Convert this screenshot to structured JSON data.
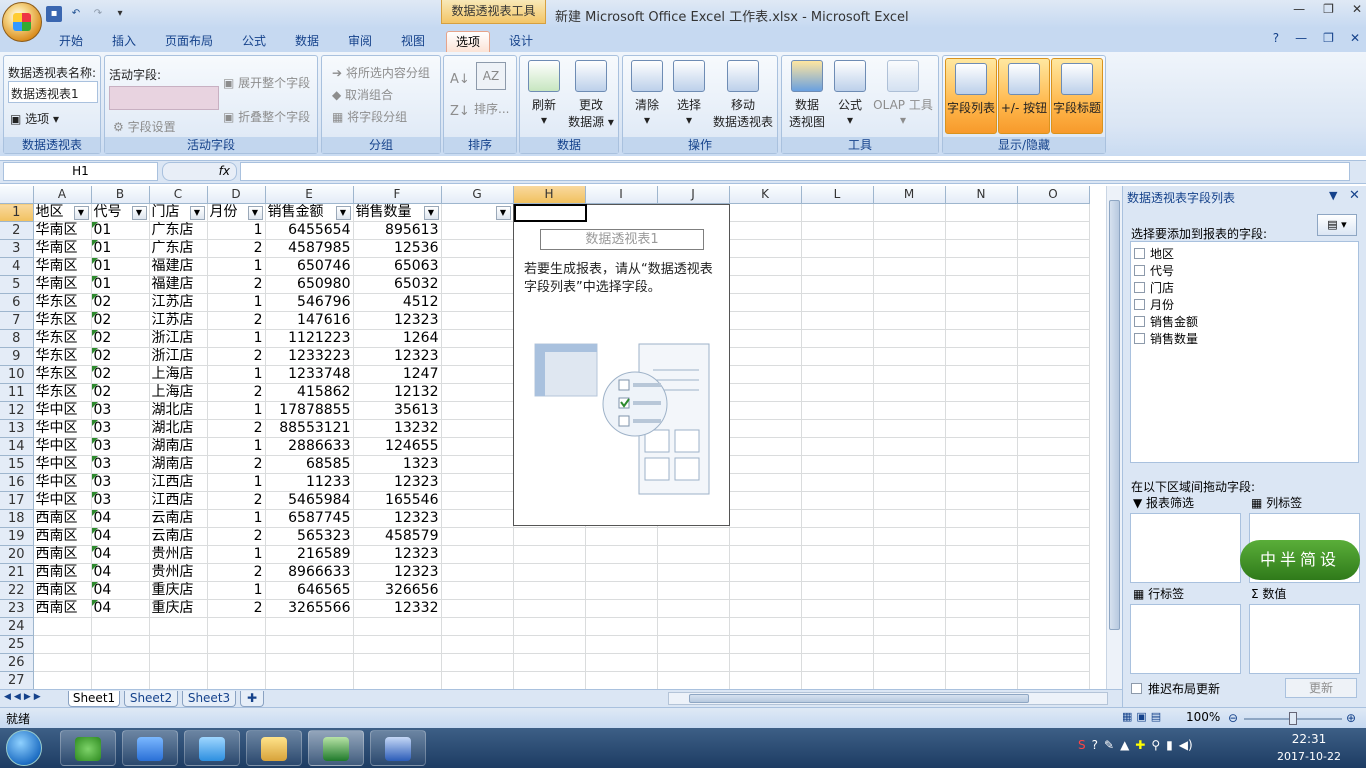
{
  "window": {
    "title": "新建 Microsoft Office Excel 工作表.xlsx - Microsoft Excel",
    "context_tab": "数据透视表工具"
  },
  "tabs": [
    "开始",
    "插入",
    "页面布局",
    "公式",
    "数据",
    "审阅",
    "视图",
    "选项",
    "设计"
  ],
  "active_tab": "选项",
  "ribbon": {
    "pivot": {
      "name_label": "数据透视表名称:",
      "name_value": "数据透视表1",
      "options": "选项",
      "group": "数据透视表"
    },
    "active_field": {
      "label": "活动字段:",
      "field_settings": "字段设置",
      "expand": "展开整个字段",
      "collapse": "折叠整个字段",
      "group": "活动字段"
    },
    "grouping": {
      "group_selection": "将所选内容分组",
      "ungroup": "取消组合",
      "group_field": "将字段分组",
      "group": "分组"
    },
    "sort": {
      "sort": "排序...",
      "group": "排序"
    },
    "data": {
      "refresh": "刷新",
      "change_source_1": "更改",
      "change_source_2": "数据源",
      "group": "数据"
    },
    "actions": {
      "clear": "清除",
      "select": "选择",
      "move_1": "移动",
      "move_2": "数据透视表",
      "group": "操作"
    },
    "tools": {
      "pivotchart_1": "数据",
      "pivotchart_2": "透视图",
      "formulas": "公式",
      "olap": "OLAP 工具",
      "group": "工具"
    },
    "show_hide": {
      "field_list": "字段列表",
      "buttons": "+/- 按钮",
      "headers": "字段标题",
      "group": "显示/隐藏"
    }
  },
  "formula_bar": {
    "name_box": "H1",
    "fx": "fx"
  },
  "columns": [
    "A",
    "B",
    "C",
    "D",
    "E",
    "F",
    "G",
    "H",
    "I",
    "J",
    "K",
    "L",
    "M",
    "N",
    "O"
  ],
  "headers": [
    "地区",
    "代号",
    "门店",
    "月份",
    "销售金额",
    "销售数量"
  ],
  "rows": [
    [
      "华南区",
      "01",
      "广东店",
      "1",
      "6455654",
      "895613"
    ],
    [
      "华南区",
      "01",
      "广东店",
      "2",
      "4587985",
      "12536"
    ],
    [
      "华南区",
      "01",
      "福建店",
      "1",
      "650746",
      "65063"
    ],
    [
      "华南区",
      "01",
      "福建店",
      "2",
      "650980",
      "65032"
    ],
    [
      "华东区",
      "02",
      "江苏店",
      "1",
      "546796",
      "4512"
    ],
    [
      "华东区",
      "02",
      "江苏店",
      "2",
      "147616",
      "12323"
    ],
    [
      "华东区",
      "02",
      "浙江店",
      "1",
      "1121223",
      "1264"
    ],
    [
      "华东区",
      "02",
      "浙江店",
      "2",
      "1233223",
      "12323"
    ],
    [
      "华东区",
      "02",
      "上海店",
      "1",
      "1233748",
      "1247"
    ],
    [
      "华东区",
      "02",
      "上海店",
      "2",
      "415862",
      "12132"
    ],
    [
      "华中区",
      "03",
      "湖北店",
      "1",
      "17878855",
      "35613"
    ],
    [
      "华中区",
      "03",
      "湖北店",
      "2",
      "88553121",
      "13232"
    ],
    [
      "华中区",
      "03",
      "湖南店",
      "1",
      "2886633",
      "124655"
    ],
    [
      "华中区",
      "03",
      "湖南店",
      "2",
      "68585",
      "1323"
    ],
    [
      "华中区",
      "03",
      "江西店",
      "1",
      "11233",
      "12323"
    ],
    [
      "华中区",
      "03",
      "江西店",
      "2",
      "5465984",
      "165546"
    ],
    [
      "西南区",
      "04",
      "云南店",
      "1",
      "6587745",
      "12323"
    ],
    [
      "西南区",
      "04",
      "云南店",
      "2",
      "565323",
      "458579"
    ],
    [
      "西南区",
      "04",
      "贵州店",
      "1",
      "216589",
      "12323"
    ],
    [
      "西南区",
      "04",
      "贵州店",
      "2",
      "8966633",
      "12323"
    ],
    [
      "西南区",
      "04",
      "重庆店",
      "1",
      "646565",
      "326656"
    ],
    [
      "西南区",
      "04",
      "重庆店",
      "2",
      "3265566",
      "12332"
    ]
  ],
  "row_numbers": [
    "1",
    "2",
    "3",
    "4",
    "5",
    "6",
    "7",
    "8",
    "9",
    "10",
    "11",
    "12",
    "13",
    "14",
    "15",
    "16",
    "17",
    "18",
    "19",
    "20",
    "21",
    "22",
    "23",
    "24",
    "25",
    "26",
    "27"
  ],
  "pivot_placeholder": {
    "title": "数据透视表1",
    "message": "若要生成报表，请从“数据透视表字段列表”中选择字段。"
  },
  "sheet_tabs": [
    "Sheet1",
    "Sheet2",
    "Sheet3"
  ],
  "status": {
    "ready": "就绪",
    "zoom": "100%"
  },
  "field_pane": {
    "title": "数据透视表字段列表",
    "choose_label": "选择要添加到报表的字段:",
    "fields": [
      "地区",
      "代号",
      "门店",
      "月份",
      "销售金额",
      "销售数量"
    ],
    "drag_label": "在以下区域间拖动字段:",
    "report_filter": "报表筛选",
    "column_labels": "列标签",
    "row_labels": "行标签",
    "values": "数值",
    "defer": "推迟布局更新",
    "update": "更新"
  },
  "watermark": "中半简设",
  "clock": {
    "time": "22:31",
    "date": "2017-10-22"
  }
}
